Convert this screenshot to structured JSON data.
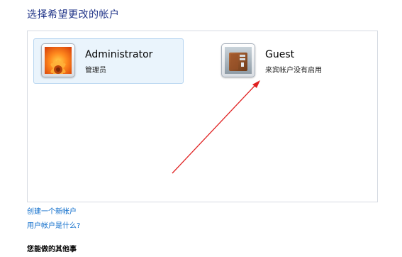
{
  "header": {
    "title": "选择希望更改的帐户"
  },
  "accounts": [
    {
      "name": "Administrator",
      "status": "管理员",
      "avatar_icon": "flower-avatar-icon"
    },
    {
      "name": "Guest",
      "status": "来宾帐户没有启用",
      "avatar_icon": "briefcase-avatar-icon"
    }
  ],
  "links": {
    "create_account": "创建一个新帐户",
    "what_is_account": "用户帐户是什么?"
  },
  "other_tasks": {
    "heading": "您能做的其他事"
  },
  "annotation": {
    "arrow_color": "#e02020"
  }
}
